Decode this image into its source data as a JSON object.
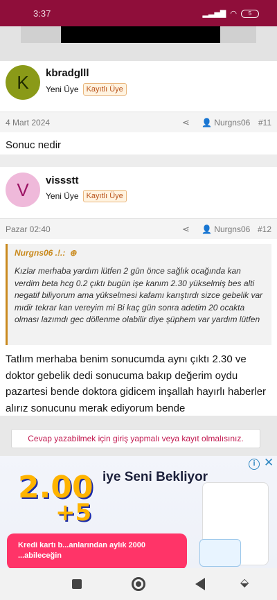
{
  "status_bar": {
    "time": "3:37",
    "battery": "5"
  },
  "posts": [
    {
      "avatar_letter": "K",
      "username": "kbradglll",
      "role": "Yeni Üye",
      "badge": "Kayıtlı Üye",
      "date": "4 Mart 2024",
      "author": "Nurgns06",
      "number": "#11",
      "message": "Sonuc nedir"
    },
    {
      "avatar_letter": "V",
      "username": "vissstt",
      "role": "Yeni Üye",
      "badge": "Kayıtlı Üye",
      "date": "Pazar 02:40",
      "author": "Nurgns06",
      "number": "#12",
      "message": "Tatlım merhaba benim sonucumda aynı çıktı 2.30 ve doktor gebelik dedi sonucuma bakıp değerim oydu pazartesi bende doktora gidicem inşallah hayırlı haberler alırız sonucunu merak ediyorum bende"
    }
  ],
  "quote": {
    "author": "Nurgns06 .!.:",
    "text": "Kızlar merhaba yardım lütfen 2 gün önce sağlık ocağında kan verdim beta hcg 0.2 çıktı bugün işe kanım 2.30 yükselmiş bes alti negatif biliyorum ama yükselmesi kafamı karıştırdı sizce gebelik var mıdir tekrar kan vereyim mi Bi kaç gün sonra adetim 20 ocakta olması lazımdı gec döllenme olabilir diye şüphem var yardım lütfen"
  },
  "reply_prompt": "Cevap yazabilmek için giriş yapmalı veya kayıt olmalısınız.",
  "ad": {
    "big_number": "2.00",
    "plus": "+5",
    "headline": "iye Seni Bekliyor",
    "body": "Kredi kartı b...anlarından aylık 2000 ...abileceğin",
    "info": "i",
    "close": "✕"
  },
  "colors": {
    "status_bar": "#8f0e3a",
    "badge": "#b9531a",
    "accent": "#c1184f",
    "quote_border": "#c98a1e"
  }
}
